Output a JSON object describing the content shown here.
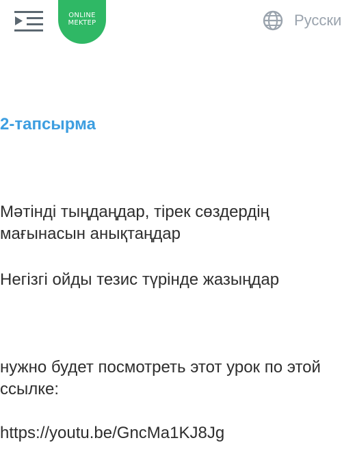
{
  "header": {
    "logo_line1": "ONLINE",
    "logo_line2": "MEKTEP",
    "language_label": "Русский",
    "icons": [
      "menu-collapse-icon",
      "globe-icon"
    ],
    "logo_color": "#2fb865"
  },
  "content": {
    "task_title": "2-тапсырма",
    "task_title_color": "#3d9ee0",
    "paragraph_1": "Мәтінді тыңдаңдар, тірек сөздердің мағынасын анықтаңдар",
    "paragraph_2": "Негізгі ойды тезис түрінде жазыңдар",
    "note": "нужно будет посмотреть этот урок по этой ссылке:",
    "link": "https://youtu.be/GncMa1KJ8Jg"
  }
}
